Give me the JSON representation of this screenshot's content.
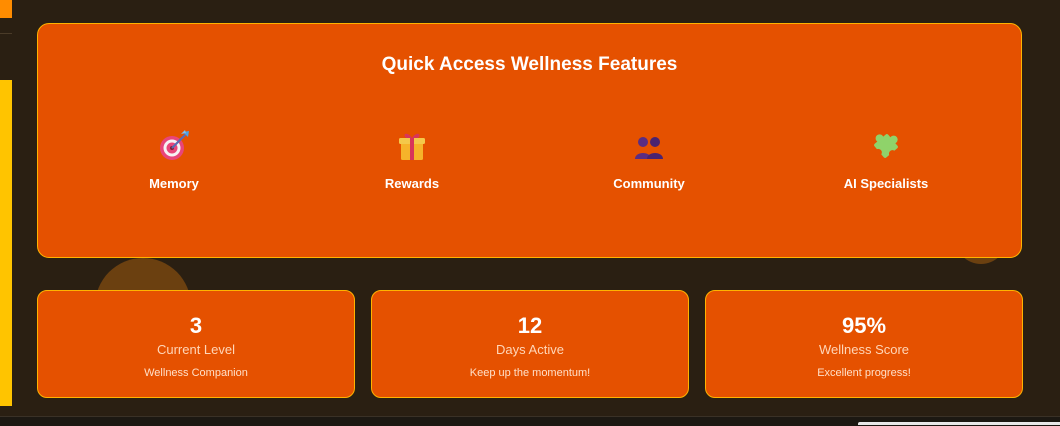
{
  "features": {
    "title": "Quick Access Wellness Features",
    "items": [
      {
        "label": "Memory",
        "icon": "target-icon"
      },
      {
        "label": "Rewards",
        "icon": "gift-icon"
      },
      {
        "label": "Community",
        "icon": "people-icon"
      },
      {
        "label": "AI Specialists",
        "icon": "puzzle-icon"
      }
    ]
  },
  "stats": [
    {
      "value": "3",
      "label": "Current Level",
      "sub": "Wellness Companion"
    },
    {
      "value": "12",
      "label": "Days Active",
      "sub": "Keep up the momentum!"
    },
    {
      "value": "95%",
      "label": "Wellness Score",
      "sub": "Excellent progress!"
    }
  ],
  "colors": {
    "background": "#2a1f12",
    "card": "#e55100",
    "card_border": "#ffb300",
    "rail": "#ffc400"
  }
}
